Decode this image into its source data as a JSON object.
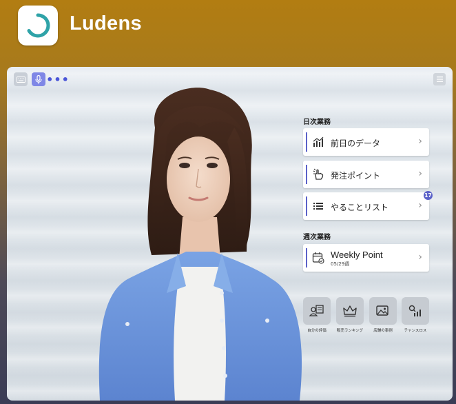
{
  "app": {
    "name": "Ludens"
  },
  "daily": {
    "title": "日次業務",
    "items": [
      {
        "label": "前日のデータ",
        "icon": "chart-icon"
      },
      {
        "label": "発注ポイント",
        "icon": "hand-pointer-icon"
      },
      {
        "label": "やることリスト",
        "icon": "list-icon",
        "badge": "17"
      }
    ]
  },
  "weekly": {
    "title": "週次業務",
    "item": {
      "label": "Weekly Point",
      "sub": "05/29週",
      "icon": "calendar-check-icon"
    }
  },
  "quick_actions": [
    {
      "label": "自分の評価",
      "icon": "person-doc-icon"
    },
    {
      "label": "販売ランキング",
      "icon": "crown-icon"
    },
    {
      "label": "店舗の事例",
      "icon": "image-icon"
    },
    {
      "label": "チャンスロス",
      "icon": "search-chart-icon"
    }
  ],
  "colors": {
    "accent": "#5b62c9",
    "brand_teal": "#2fa3a8"
  }
}
